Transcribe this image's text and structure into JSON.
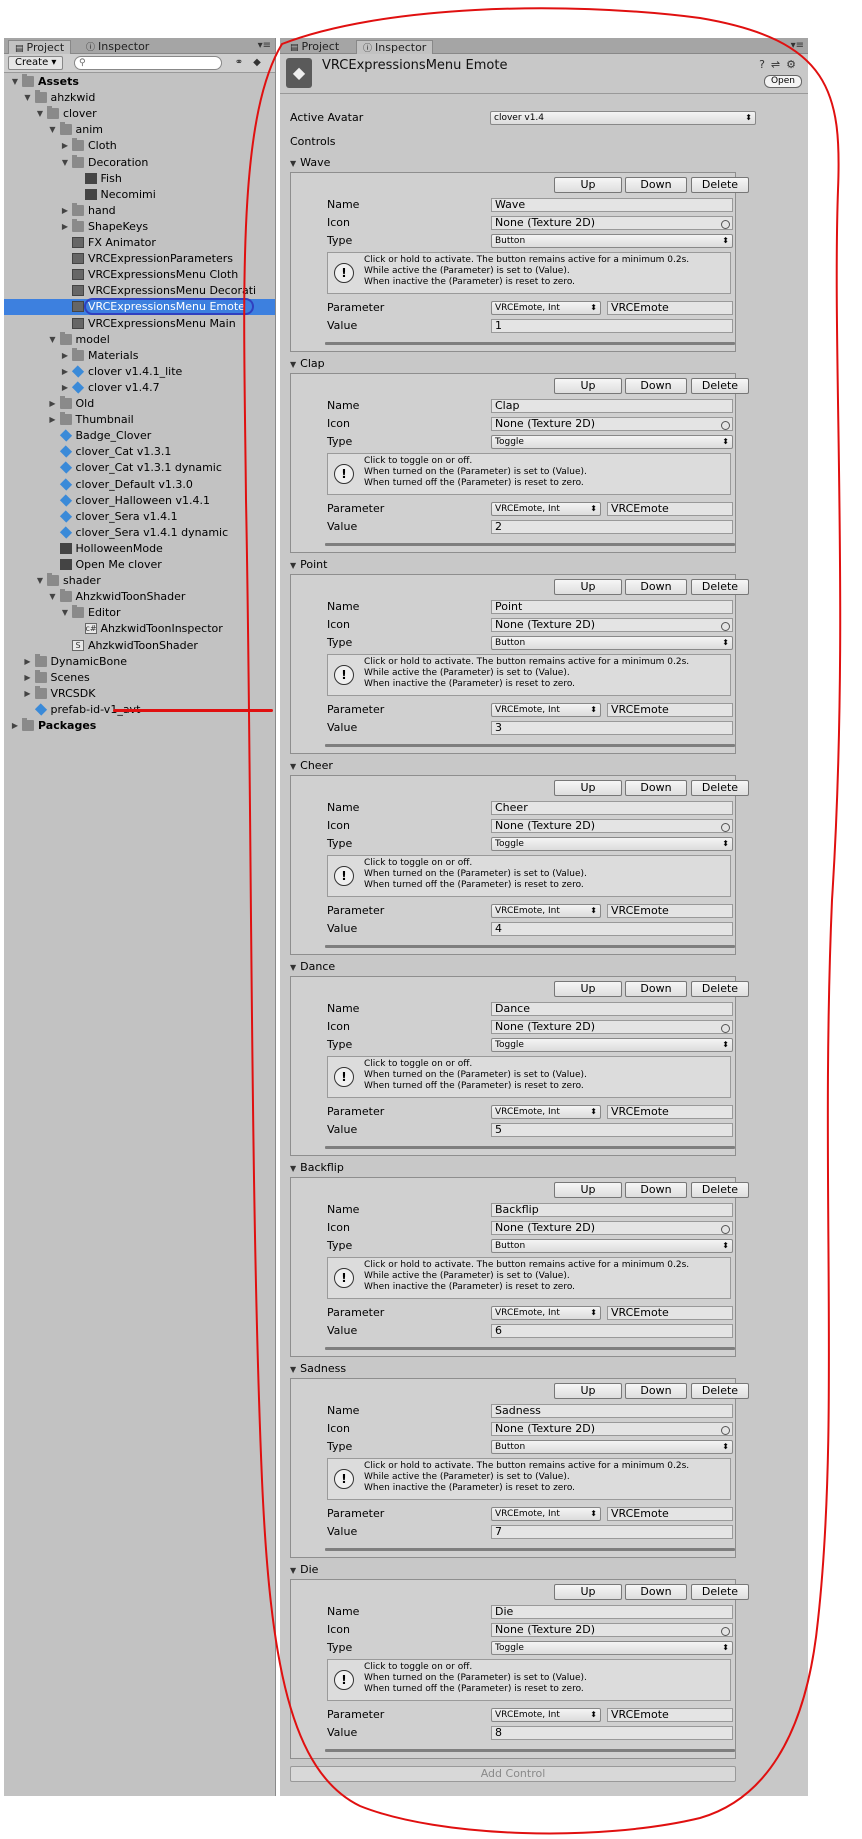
{
  "left_panel": {
    "tabs": [
      "Project",
      "Inspector"
    ],
    "create_label": "Create",
    "search_placeholder": "",
    "tree": [
      {
        "label": "Assets",
        "depth": 0,
        "kind": "folder",
        "expanded": true,
        "bold": true
      },
      {
        "label": "ahzkwid",
        "depth": 1,
        "kind": "folder",
        "expanded": true
      },
      {
        "label": "clover",
        "depth": 2,
        "kind": "folder",
        "expanded": true
      },
      {
        "label": "anim",
        "depth": 3,
        "kind": "folder",
        "expanded": true
      },
      {
        "label": "Cloth",
        "depth": 4,
        "kind": "folder",
        "expanded": false
      },
      {
        "label": "Decoration",
        "depth": 4,
        "kind": "folder",
        "expanded": true
      },
      {
        "label": "Fish",
        "depth": 5,
        "kind": "anim"
      },
      {
        "label": "Necomimi",
        "depth": 5,
        "kind": "anim"
      },
      {
        "label": "hand",
        "depth": 4,
        "kind": "folder",
        "expanded": false
      },
      {
        "label": "ShapeKeys",
        "depth": 4,
        "kind": "folder",
        "expanded": false
      },
      {
        "label": "FX Animator",
        "depth": 4,
        "kind": "controller"
      },
      {
        "label": "VRCExpressionParameters",
        "depth": 4,
        "kind": "asset"
      },
      {
        "label": "VRCExpressionsMenu Cloth",
        "depth": 4,
        "kind": "asset"
      },
      {
        "label": "VRCExpressionsMenu Decorati",
        "depth": 4,
        "kind": "asset"
      },
      {
        "label": "VRCExpressionsMenu Emote",
        "depth": 4,
        "kind": "asset",
        "selected": true
      },
      {
        "label": "VRCExpressionsMenu Main",
        "depth": 4,
        "kind": "asset"
      },
      {
        "label": "model",
        "depth": 3,
        "kind": "folder",
        "expanded": true
      },
      {
        "label": "Materials",
        "depth": 4,
        "kind": "folder",
        "expanded": false
      },
      {
        "label": "clover v1.4.1_lite",
        "depth": 4,
        "kind": "prefab",
        "expanded": false
      },
      {
        "label": "clover v1.4.7",
        "depth": 4,
        "kind": "prefab",
        "expanded": false
      },
      {
        "label": "Old",
        "depth": 3,
        "kind": "folder",
        "expanded": false
      },
      {
        "label": "Thumbnail",
        "depth": 3,
        "kind": "folder",
        "expanded": false
      },
      {
        "label": "Badge_Clover",
        "depth": 3,
        "kind": "cube"
      },
      {
        "label": "clover_Cat v1.3.1",
        "depth": 3,
        "kind": "cube"
      },
      {
        "label": "clover_Cat v1.3.1 dynamic",
        "depth": 3,
        "kind": "cube"
      },
      {
        "label": "clover_Default v1.3.0",
        "depth": 3,
        "kind": "cube"
      },
      {
        "label": "clover_Halloween v1.4.1",
        "depth": 3,
        "kind": "cube"
      },
      {
        "label": "clover_Sera v1.4.1",
        "depth": 3,
        "kind": "cube"
      },
      {
        "label": "clover_Sera v1.4.1 dynamic",
        "depth": 3,
        "kind": "cube"
      },
      {
        "label": "HolloweenMode",
        "depth": 3,
        "kind": "anim"
      },
      {
        "label": "Open Me clover",
        "depth": 3,
        "kind": "unity"
      },
      {
        "label": "shader",
        "depth": 2,
        "kind": "folder",
        "expanded": true
      },
      {
        "label": "AhzkwidToonShader",
        "depth": 3,
        "kind": "folder",
        "expanded": true
      },
      {
        "label": "Editor",
        "depth": 4,
        "kind": "folder",
        "expanded": true
      },
      {
        "label": "AhzkwidToonInspector",
        "depth": 5,
        "kind": "script"
      },
      {
        "label": "AhzkwidToonShader",
        "depth": 4,
        "kind": "shader"
      },
      {
        "label": "DynamicBone",
        "depth": 1,
        "kind": "folder",
        "expanded": false
      },
      {
        "label": "Scenes",
        "depth": 1,
        "kind": "folder",
        "expanded": false
      },
      {
        "label": "VRCSDK",
        "depth": 1,
        "kind": "folder",
        "expanded": false
      },
      {
        "label": "prefab-id-v1_avt",
        "depth": 1,
        "kind": "cube",
        "redacted": true
      },
      {
        "label": "Packages",
        "depth": 0,
        "kind": "folder",
        "expanded": false,
        "bold": true
      }
    ]
  },
  "inspector": {
    "tabs": [
      "Project",
      "Inspector"
    ],
    "title": "VRCExpressionsMenu Emote",
    "open_label": "Open",
    "active_avatar_label": "Active Avatar",
    "active_avatar_value": "clover v1.4",
    "controls_label": "Controls",
    "field_labels": {
      "name": "Name",
      "icon": "Icon",
      "type": "Type",
      "parameter": "Parameter",
      "value": "Value"
    },
    "button_labels": {
      "up": "Up",
      "down": "Down",
      "delete": "Delete"
    },
    "help_button": [
      "Click or hold to activate. The button remains active for a minimum 0.2s.",
      "While active the (Parameter) is set to (Value).",
      "When inactive the (Parameter) is reset to zero."
    ],
    "help_toggle": [
      "Click to toggle on or off.",
      "When turned on the (Parameter) is set to (Value).",
      "When turned off the (Parameter) is reset to zero."
    ],
    "controls": [
      {
        "name": "Wave",
        "icon": "None (Texture 2D)",
        "type": "Button",
        "param_type": "VRCEmote, Int",
        "parameter": "VRCEmote",
        "value": "1"
      },
      {
        "name": "Clap",
        "icon": "None (Texture 2D)",
        "type": "Toggle",
        "param_type": "VRCEmote, Int",
        "parameter": "VRCEmote",
        "value": "2"
      },
      {
        "name": "Point",
        "icon": "None (Texture 2D)",
        "type": "Button",
        "param_type": "VRCEmote, Int",
        "parameter": "VRCEmote",
        "value": "3"
      },
      {
        "name": "Cheer",
        "icon": "None (Texture 2D)",
        "type": "Toggle",
        "param_type": "VRCEmote, Int",
        "parameter": "VRCEmote",
        "value": "4"
      },
      {
        "name": "Dance",
        "icon": "None (Texture 2D)",
        "type": "Toggle",
        "param_type": "VRCEmote, Int",
        "parameter": "VRCEmote",
        "value": "5"
      },
      {
        "name": "Backflip",
        "icon": "None (Texture 2D)",
        "type": "Button",
        "param_type": "VRCEmote, Int",
        "parameter": "VRCEmote",
        "value": "6"
      },
      {
        "name": "Sadness",
        "icon": "None (Texture 2D)",
        "type": "Button",
        "param_type": "VRCEmote, Int",
        "parameter": "VRCEmote",
        "value": "7"
      },
      {
        "name": "Die",
        "icon": "None (Texture 2D)",
        "type": "Toggle",
        "param_type": "VRCEmote, Int",
        "parameter": "VRCEmote",
        "value": "8"
      }
    ],
    "add_control_label": "Add Control"
  },
  "colors": {
    "selection": "#3d80df",
    "annotation": "#e01010",
    "ring": "#3040c0"
  }
}
